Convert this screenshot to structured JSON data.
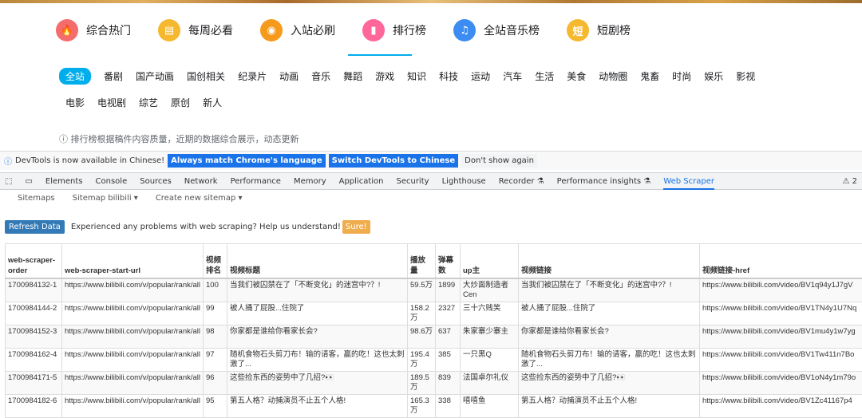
{
  "top_nav": [
    {
      "label": "综合热门",
      "icon": "fire-icon",
      "glyph": "🔥",
      "color": "#f56c6c"
    },
    {
      "label": "每周必看",
      "icon": "calendar-icon",
      "glyph": "▤",
      "color": "#f5b82e"
    },
    {
      "label": "入站必刷",
      "icon": "medal-icon",
      "glyph": "◉",
      "color": "#f59a1a"
    },
    {
      "label": "排行榜",
      "icon": "ranking-icon",
      "glyph": "▮",
      "color": "#ff6699"
    },
    {
      "label": "全站音乐榜",
      "icon": "music-icon",
      "glyph": "♫",
      "color": "#3c8cf2"
    },
    {
      "label": "短剧榜",
      "icon": "short-drama-icon",
      "glyph": "短",
      "color": "#f5b82e"
    }
  ],
  "categories_row1": [
    "全站",
    "番剧",
    "国产动画",
    "国创相关",
    "纪录片",
    "动画",
    "音乐",
    "舞蹈",
    "游戏",
    "知识",
    "科技",
    "运动",
    "汽车",
    "生活",
    "美食",
    "动物圈",
    "鬼畜",
    "时尚",
    "娱乐",
    "影视"
  ],
  "categories_row2": [
    "电影",
    "电视剧",
    "综艺",
    "原创",
    "新人"
  ],
  "note": "ⓘ 排行榜根据稿件内容质量，近期的数据综合展示，动态更新",
  "devtools_info": {
    "text": "DevTools is now available in Chinese!",
    "btn_match": "Always match Chrome's language",
    "btn_switch": "Switch DevTools to Chinese",
    "btn_dismiss": "Don't show again"
  },
  "devtools_tabs": [
    "Elements",
    "Console",
    "Sources",
    "Network",
    "Performance",
    "Memory",
    "Application",
    "Security",
    "Lighthouse",
    "Recorder ⚗",
    "Performance insights ⚗",
    "Web Scraper"
  ],
  "devtools_warning": "⚠ 2",
  "scraper_tabs": [
    "Sitemaps",
    "Sitemap bilibili ▾",
    "Create new sitemap ▾"
  ],
  "actions": {
    "refresh": "Refresh Data",
    "message": "Experienced any problems with web scraping? Help us understand!",
    "sure": "Sure!"
  },
  "table": {
    "headers": [
      "web-scraper-order",
      "web-scraper-start-url",
      "视频排名",
      "视频标题",
      "播放量",
      "弹幕数",
      "up主",
      "视频链接",
      "视频链接-href"
    ],
    "rows": [
      [
        "1700984132-1",
        "https://www.bilibili.com/v/popular/rank/all",
        "100",
        "当我们被囚禁在了「不断变化」的迷宫中?？!",
        "59.5万",
        "1899",
        "大炒面制造者Cen",
        "当我们被囚禁在了「不断变化」的迷宫中?？!",
        "https://www.bilibili.com/video/BV1q94y1J7gV"
      ],
      [
        "1700984144-2",
        "https://www.bilibili.com/v/popular/rank/all",
        "99",
        "被人捅了屁股...住院了",
        "158.2万",
        "2327",
        "三十六贱笑",
        "被人捅了屁股...住院了",
        "https://www.bilibili.com/video/BV1TN4y1U7Nq"
      ],
      [
        "1700984152-3",
        "https://www.bilibili.com/v/popular/rank/all",
        "98",
        "你家都是谁给你看家长会?",
        "98.6万",
        "637",
        "朱家寨少寨主",
        "你家都是谁给你看家长会?",
        "https://www.bilibili.com/video/BV1mu4y1w7yg"
      ],
      [
        "1700984162-4",
        "https://www.bilibili.com/v/popular/rank/all",
        "97",
        "随机食物石头剪刀布！输的请客，赢的吃！这也太刺激了...",
        "195.4万",
        "385",
        "一只黑Q",
        "随机食物石头剪刀布！输的请客，赢的吃！这也太刺激了...",
        "https://www.bilibili.com/video/BV1Tw411n7Bo"
      ],
      [
        "1700984171-5",
        "https://www.bilibili.com/v/popular/rank/all",
        "96",
        "这些捡东西的姿势中了几招?👀",
        "189.5万",
        "839",
        "法国卓尔礼仪",
        "这些捡东西的姿势中了几招?👀",
        "https://www.bilibili.com/video/BV1oN4y1m79o"
      ],
      [
        "1700984182-6",
        "https://www.bilibili.com/v/popular/rank/all",
        "95",
        "第五人格？动捕演员不止五个人格!",
        "165.3万",
        "338",
        "嘻嘻鱼",
        "第五人格？动捕演员不止五个人格!",
        "https://www.bilibili.com/video/BV1Zc41167p4"
      ]
    ]
  }
}
